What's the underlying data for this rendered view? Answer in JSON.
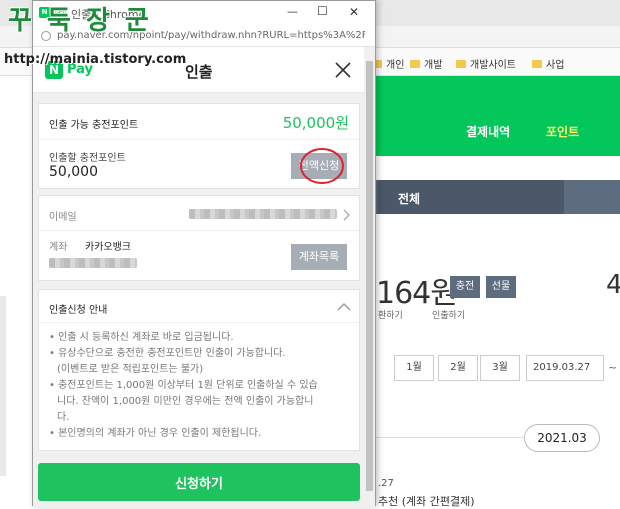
{
  "watermark": {
    "line1": "꾸 둑 장 군",
    "line2": "http://mainia.tistory.com"
  },
  "window": {
    "tab_title": "인출 - Chrome",
    "url": "pay.naver.com/npoint/pay/withdraw.nhn?RURL=https%3A%2F...",
    "minimize": "—",
    "maximize": "☐",
    "close": "✕"
  },
  "popup": {
    "logo": "N Pay",
    "title": "인출",
    "available_label": "인출 가능 충전포인트",
    "available_value": "50,000원",
    "amount_label": "인출할 충전포인트",
    "amount_value": "50,000",
    "full_button": "전액신청",
    "email_label": "이메일",
    "account_label": "계좌",
    "bank_name": "카카오뱅크",
    "account_button": "계좌목록",
    "notice_title": "인출신청 안내",
    "notices": [
      "• 인출 시 등록하신 계좌로 바로 입금됩니다.",
      "• 유상수단으로 충전한 충전포인트만 인출이 가능합니다.",
      "  (이벤트로 받은 적립포인트는 불가)",
      "• 충전포인트는 1,000원 이상부터 1원 단위로 인출하실 수 있습",
      "  니다. 잔액이 1,000원 미만인 경우에는 전액 인출이 가능합니",
      "  다.",
      "• 본인명의의 계좌가 아닌 경우 인출이 제한됩니다."
    ],
    "submit": "신청하기"
  },
  "background": {
    "bookmarks": [
      "개인",
      "개발",
      "개발사이트",
      "사업"
    ],
    "nav": [
      "결제내역",
      "포인트"
    ],
    "tab_all": "전체",
    "amount": "164원",
    "btn_charge": "충전",
    "btn_gift": "선물",
    "link_convert": "환하기",
    "link_withdraw": "인출하기",
    "right_digit": "4",
    "periods": [
      "1월",
      "2월",
      "3월"
    ],
    "date_from": "2019.03.27",
    "tilde": "~",
    "date_pill": "2021.03",
    "bottom1": ".27",
    "bottom2": "추천 (계좌 간편결제)"
  },
  "colors": {
    "naver_green": "#03c75a",
    "point_green": "#1ec25f",
    "gray_button": "#a7adb5",
    "highlight_circle": "#e0202a"
  }
}
